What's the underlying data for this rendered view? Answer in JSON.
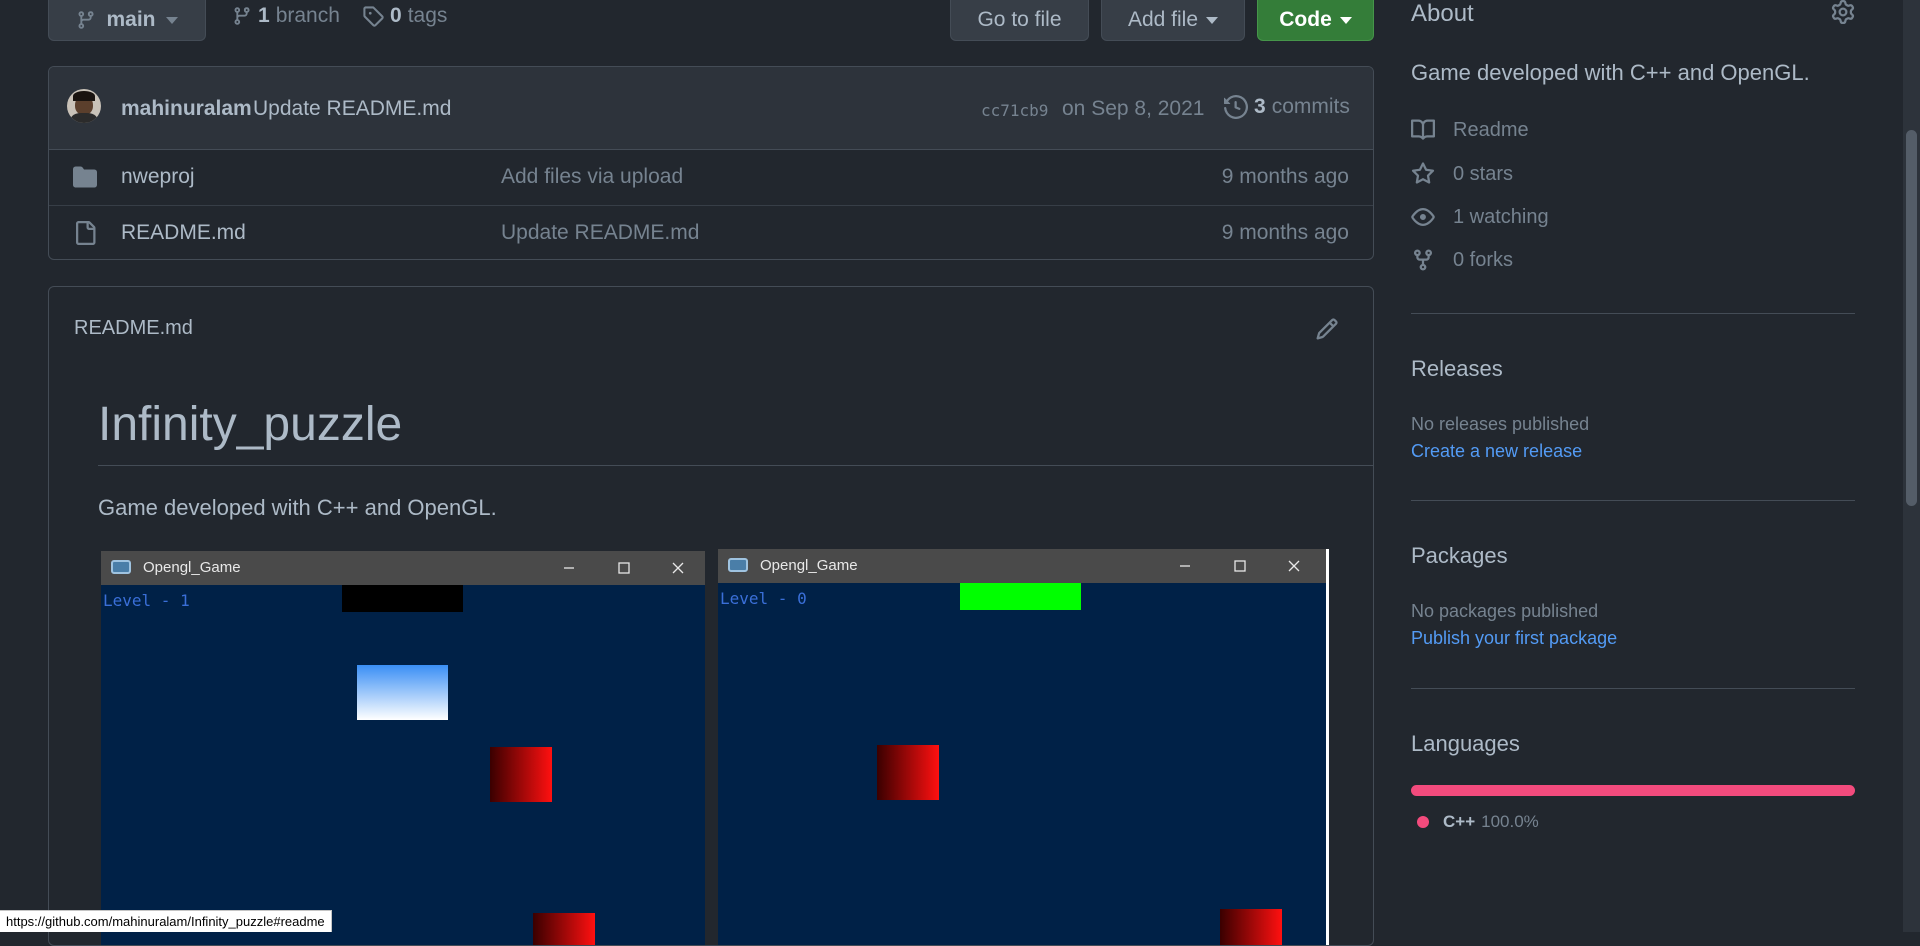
{
  "topbar": {
    "branch_label": "main",
    "branches_count": "1",
    "branches_label": "branch",
    "tags_count": "0",
    "tags_label": "tags",
    "go_to_file": "Go to file",
    "add_file": "Add file",
    "code": "Code"
  },
  "commit": {
    "author": "mahinuralam",
    "message": "Update README.md",
    "sha": "cc71cb9",
    "date": "on Sep 8, 2021",
    "commits_count": "3",
    "commits_label": "commits"
  },
  "files": [
    {
      "name": "nweproj",
      "type": "folder",
      "message": "Add files via upload",
      "age": "9 months ago"
    },
    {
      "name": "README.md",
      "type": "file",
      "message": "Update README.md",
      "age": "9 months ago"
    }
  ],
  "readme": {
    "filename": "README.md",
    "title": "Infinity_puzzle",
    "description": "Game developed with C++ and OpenGL.",
    "screenshots": [
      {
        "window_title": "Opengl_Game",
        "level_text": "Level - 1"
      },
      {
        "window_title": "Opengl_Game",
        "level_text": "Level - 0"
      }
    ]
  },
  "sidebar": {
    "about_heading": "About",
    "about_text": "Game developed with C++ and OpenGL.",
    "readme_label": "Readme",
    "stars": "0 stars",
    "watching": "1 watching",
    "forks": "0 forks",
    "releases_heading": "Releases",
    "releases_empty": "No releases published",
    "releases_link": "Create a new release",
    "packages_heading": "Packages",
    "packages_empty": "No packages published",
    "packages_link": "Publish your first package",
    "languages_heading": "Languages",
    "languages": [
      {
        "name": "C++",
        "percent": "100.0%",
        "fraction": 1.0,
        "color": "#f34b7d"
      }
    ]
  },
  "status_url": "https://github.com/mahinuralam/Infinity_puzzle#readme",
  "colors": {
    "background": "#22272e",
    "accent_green": "#347d39",
    "link": "#539bf5",
    "cpp": "#f34b7d"
  }
}
